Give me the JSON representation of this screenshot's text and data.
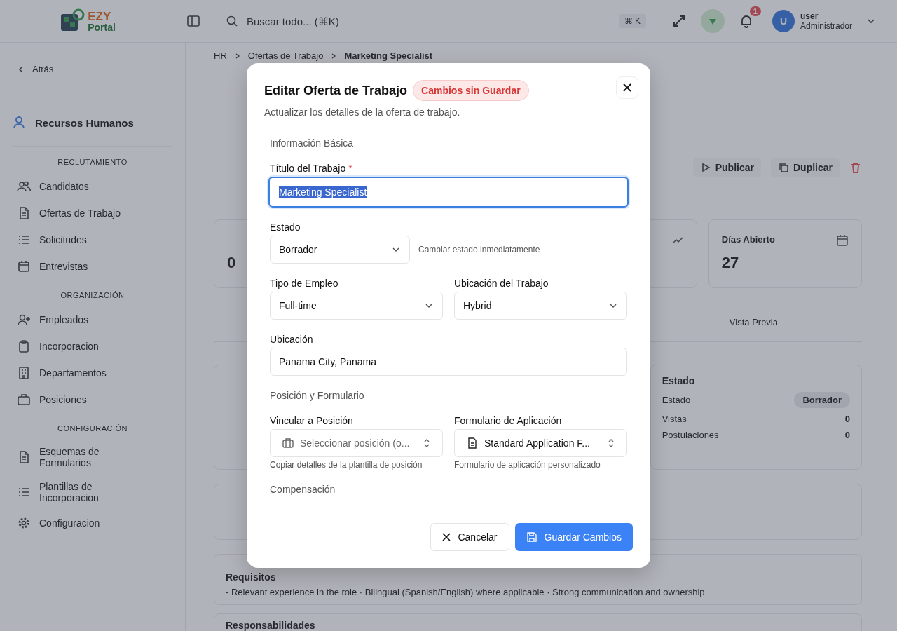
{
  "header": {
    "logo": {
      "word1": "EZY",
      "word2": "Portal"
    },
    "search": {
      "placeholder": "Buscar todo... (⌘K)",
      "shortcut": "⌘ K"
    },
    "notifications": {
      "badge": "1"
    },
    "user": {
      "initial": "U",
      "name": "user",
      "role": "Administrador"
    }
  },
  "sidebar": {
    "back": "Atrás",
    "module": "Recursos Humanos",
    "groups": [
      {
        "title": "RECLUTAMIENTO",
        "items": [
          {
            "label": "Candidatos",
            "selected": false
          },
          {
            "label": "Ofertas de Trabajo",
            "selected": false
          },
          {
            "label": "Solicitudes",
            "selected": false
          },
          {
            "label": "Entrevistas",
            "selected": false
          }
        ]
      },
      {
        "title": "ORGANIZACIÓN",
        "items": [
          {
            "label": "Empleados",
            "selected": false
          },
          {
            "label": "Incorporacion",
            "selected": false
          },
          {
            "label": "Departamentos",
            "selected": false
          },
          {
            "label": "Posiciones",
            "selected": false
          }
        ]
      },
      {
        "title": "CONFIGURACIÓN",
        "items": [
          {
            "label": "Esquemas de Formularios",
            "selected": false
          },
          {
            "label": "Plantillas de Incorporacion",
            "selected": false
          },
          {
            "label": "Configuracion",
            "selected": false
          }
        ]
      }
    ]
  },
  "breadcrumb": [
    "HR",
    "Ofertas de Trabajo",
    "Marketing Specialist"
  ],
  "actions": [
    "Publicar",
    "Duplicar"
  ],
  "stats": [
    {
      "value": "0"
    },
    {
      "label": "Días Abierto",
      "value": "27"
    }
  ],
  "tabs": [
    {
      "label": "Vista Previa",
      "selected": false
    }
  ],
  "status_card": {
    "title": "Estado",
    "rows": [
      {
        "label": "Estado",
        "value": "Borrador",
        "kind": "badge"
      },
      {
        "label": "Vistas",
        "value": "0",
        "kind": "text"
      },
      {
        "label": "Postulaciones",
        "value": "0",
        "kind": "text"
      }
    ]
  },
  "requirements": {
    "title": "Requisitos",
    "text": "- Relevant experience in the role · Bilingual (Spanish/English) where applicable · Strong communication and ownership"
  },
  "responsibilities": {
    "title": "Responsabilidades"
  },
  "dialog": {
    "title": "Editar Oferta de Trabajo",
    "badge": "Cambios sin Guardar",
    "subtitle": "Actualizar los detalles de la oferta de trabajo.",
    "sections": [
      {
        "title": "Información Básica",
        "fields": [
          {
            "kind": "input",
            "label": "Título del Trabajo",
            "required_mark": "*",
            "value": "Marketing Specialist",
            "focused": true,
            "value_selected": true
          }
        ]
      },
      {
        "fields": [
          {
            "kind": "status-select",
            "label": "Estado",
            "value": "Borrador",
            "hint": "Cambiar estado inmediatamente"
          }
        ]
      },
      {
        "fields": [
          {
            "kind": "select",
            "label": "Tipo de Empleo",
            "value": "Full-time"
          },
          {
            "kind": "select",
            "label": "Ubicación del Trabajo",
            "value": "Hybrid"
          }
        ]
      },
      {
        "fields": [
          {
            "kind": "input",
            "label": "Ubicación",
            "value": "Panama City, Panama",
            "focused": false,
            "value_selected": false
          }
        ]
      },
      {
        "title": "Posición y Formulario",
        "fields": [
          {
            "kind": "position-combo",
            "label": "Vincular a Posición",
            "placeholder": "Seleccionar posición (o...",
            "hint": "Copiar detalles de la plantilla de posición"
          },
          {
            "kind": "form-combo",
            "label": "Formulario de Aplicación",
            "value": "Standard Application F...",
            "hint": "Formulario de aplicación personalizado"
          }
        ]
      },
      {
        "title": "Compensación"
      }
    ],
    "buttons": [
      {
        "label": "Cancelar",
        "kind": "secondary"
      },
      {
        "label": "Guardar Cambios",
        "kind": "primary"
      }
    ]
  }
}
